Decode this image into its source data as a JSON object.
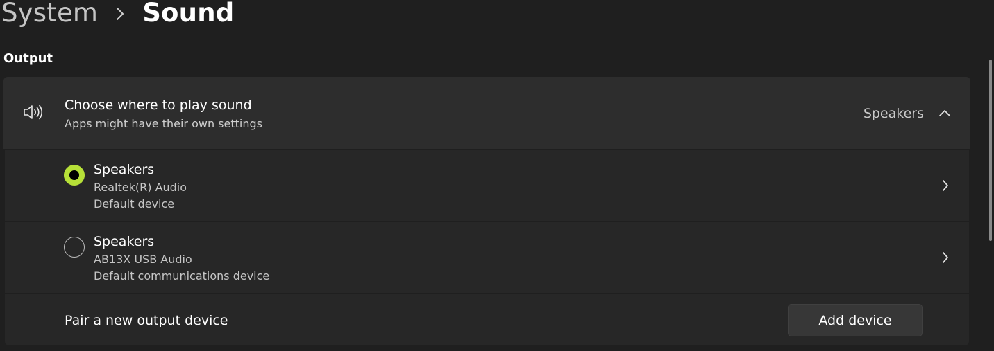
{
  "breadcrumb": {
    "parent": "System",
    "current": "Sound"
  },
  "output": {
    "section_title": "Output",
    "choose": {
      "title": "Choose where to play sound",
      "subtitle": "Apps might have their own settings",
      "current_value": "Speakers",
      "icon": "speaker-icon",
      "expanded": true
    },
    "devices": [
      {
        "name": "Speakers",
        "driver": "Realtek(R) Audio",
        "status": "Default device",
        "selected": true
      },
      {
        "name": "Speakers",
        "driver": "AB13X USB Audio",
        "status": "Default communications device",
        "selected": false
      }
    ],
    "pair": {
      "label": "Pair a new output device",
      "button_label": "Add device"
    }
  },
  "colors": {
    "accent": "#b6e038",
    "background": "#1f1f1f",
    "card": "#2d2d2d",
    "row": "#272727"
  }
}
